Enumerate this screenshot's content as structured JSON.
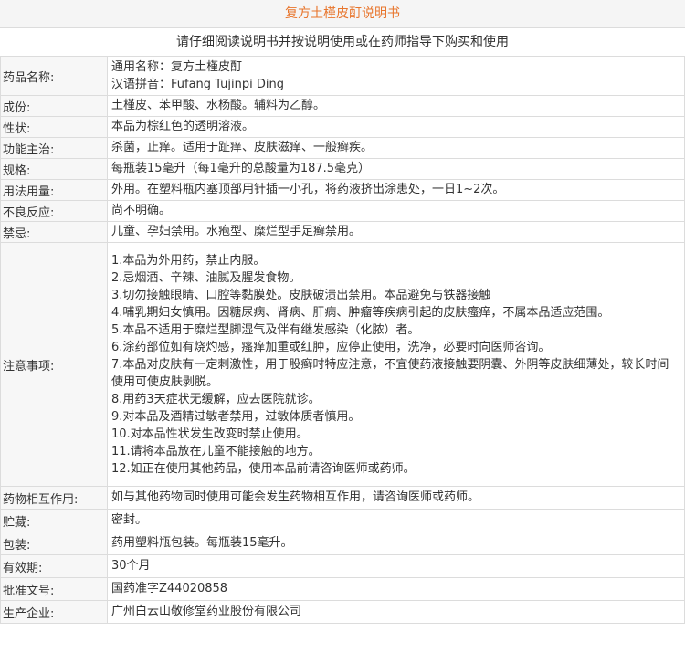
{
  "header": {
    "title": "复方土槿皮酊说明书",
    "notice": "请仔细阅读说明书并按说明使用或在药师指导下购买和使用"
  },
  "rows": {
    "name": {
      "label": "药品名称:",
      "common_name": "通用名称：复方土槿皮酊",
      "pinyin": "汉语拼音：Fufang Tujinpi Ding"
    },
    "ingredients": {
      "label": "成份:",
      "value": "土槿皮、苯甲酸、水杨酸。辅料为乙醇。"
    },
    "character": {
      "label": "性状:",
      "value": "本品为棕红色的透明溶液。"
    },
    "indications": {
      "label": "功能主治:",
      "value": "杀菌，止痒。适用于趾痒、皮肤滋痒、一般癣疾。"
    },
    "spec": {
      "label": "规格:",
      "value": "每瓶装15毫升（每1毫升的总酸量为187.5毫克）"
    },
    "dosage": {
      "label": "用法用量:",
      "value": "外用。在塑料瓶内塞顶部用针插一小孔，将药液挤出涂患处，一日1~2次。"
    },
    "adverse": {
      "label": "不良反应:",
      "value": "尚不明确。"
    },
    "contraindications": {
      "label": "禁忌:",
      "value": "儿童、孕妇禁用。水疱型、糜烂型手足癣禁用。"
    },
    "precautions": {
      "label": "注意事项:",
      "items": [
        "1.本品为外用药，禁止内服。",
        "2.忌烟酒、辛辣、油腻及腥发食物。",
        "3.切勿接触眼睛、口腔等黏膜处。皮肤破溃出禁用。本品避免与铁器接触",
        "4.哺乳期妇女慎用。因糖尿病、肾病、肝病、肿瘤等疾病引起的皮肤瘙痒，不属本品适应范围。",
        "5.本品不适用于糜烂型脚湿气及伴有继发感染（化脓）者。",
        "6.涂药部位如有烧灼感，瘙痒加重或红肿，应停止使用，洗净，必要时向医师咨询。",
        "7.本品对皮肤有一定刺激性，用于股癣时特应注意，不宜使药液接触要阴囊、外阴等皮肤细薄处，较长时间",
        "使用可使皮肤剥脱。",
        "8.用药3天症状无缓解，应去医院就诊。",
        "9.对本品及酒精过敏者禁用，过敏体质者慎用。",
        "10.对本品性状发生改变时禁止使用。",
        "11.请将本品放在儿童不能接触的地方。",
        "12.如正在使用其他药品，使用本品前请咨询医师或药师。"
      ]
    },
    "interactions": {
      "label": "药物相互作用:",
      "value": "如与其他药物同时使用可能会发生药物相互作用，请咨询医师或药师。"
    },
    "storage": {
      "label": "贮藏:",
      "value": "密封。"
    },
    "package": {
      "label": "包装:",
      "value": "药用塑料瓶包装。每瓶装15毫升。"
    },
    "validity": {
      "label": "有效期:",
      "value": "30个月"
    },
    "approval": {
      "label": "批准文号:",
      "value": "国药准字Z44020858"
    },
    "manufacturer": {
      "label": "生产企业:",
      "value": "广州白云山敬修堂药业股份有限公司"
    }
  }
}
